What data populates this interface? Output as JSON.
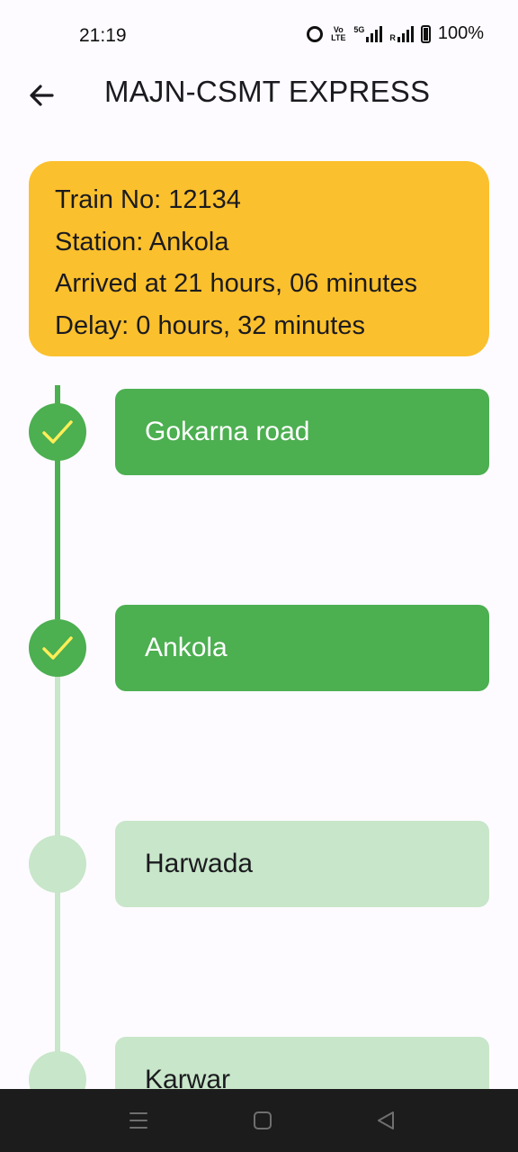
{
  "status_bar": {
    "time": "21:19",
    "volte_label": "Vo LTE",
    "network_label": "5G",
    "roaming_label": "R",
    "battery_pct": "100%"
  },
  "app_bar": {
    "back_icon": "arrow-left-icon",
    "title": "MAJN-CSMT EXPRESS"
  },
  "info_card": {
    "color": "#fbc02d",
    "train_no": "Train No: 12134",
    "station": "Station: Ankola",
    "arrived": "Arrived at 21 hours, 06 minutes",
    "delay": "Delay: 0 hours, 32 minutes"
  },
  "timeline": {
    "done_color": "#4caf50",
    "pending_color": "#c8e6c9",
    "check_color": "#ffee58",
    "stations": [
      {
        "name": "Gokarna road",
        "status": "passed"
      },
      {
        "name": "Ankola",
        "status": "passed"
      },
      {
        "name": "Harwada",
        "status": "upcoming"
      },
      {
        "name": "Karwar",
        "status": "upcoming"
      }
    ]
  },
  "nav_bar": {
    "menu_icon": "menu-icon",
    "home_icon": "home-square-icon",
    "back_icon": "back-triangle-icon"
  }
}
